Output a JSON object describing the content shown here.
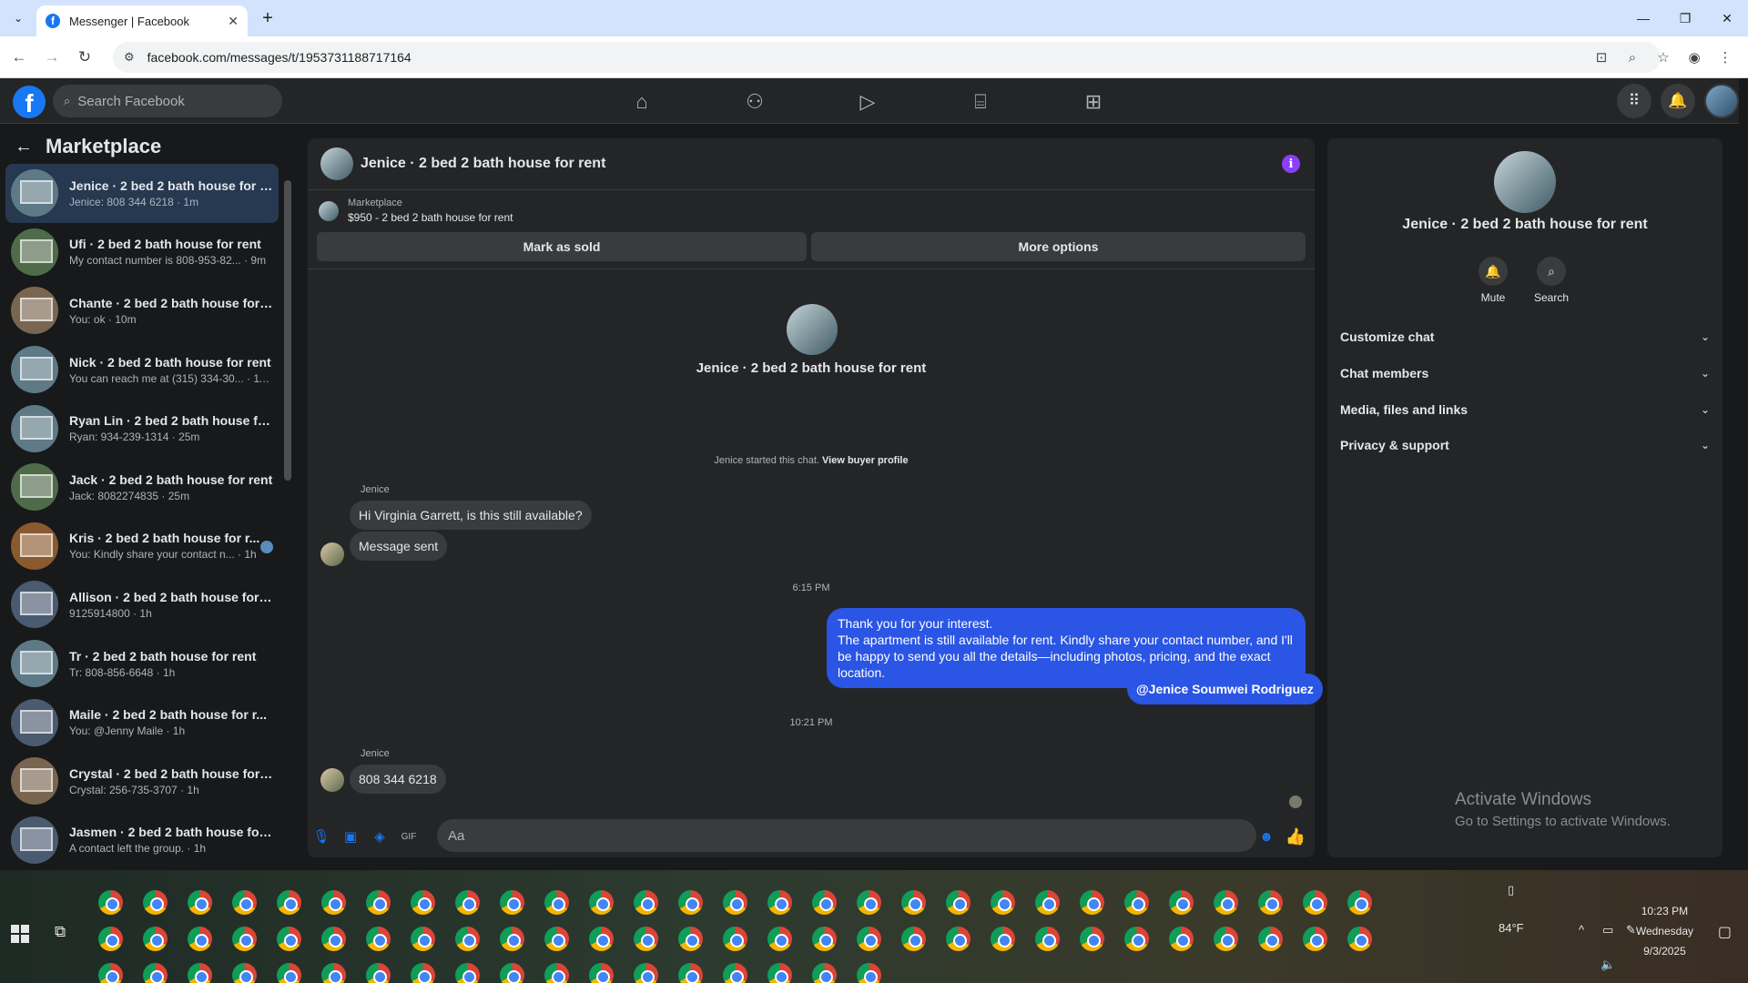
{
  "browser": {
    "tab_title": "Messenger | Facebook",
    "url": "facebook.com/messages/t/1953731188717164"
  },
  "fb": {
    "search_placeholder": "Search Facebook"
  },
  "sidebar": {
    "title": "Marketplace",
    "chats": [
      {
        "name": "Jenice · 2 bed 2 bath house for r...",
        "preview": "Jenice: 808 344 6218 · 1m",
        "active": true,
        "color": "#5d7a86"
      },
      {
        "name": "Ufi · 2 bed 2 bath house for rent",
        "preview": "My contact number is 808-953-82... · 9m",
        "active": false,
        "color": "#4f6b4a"
      },
      {
        "name": "Chante · 2 bed 2 bath house for ...",
        "preview": "You: ok · 10m",
        "active": false,
        "color": "#7a6650"
      },
      {
        "name": "Nick · 2 bed 2 bath house for rent",
        "preview": "You can reach me at (315) 334-30... · 11m",
        "active": false,
        "color": "#5d7a86"
      },
      {
        "name": "Ryan Lin · 2 bed 2 bath house fo...",
        "preview": "Ryan: 934-239-1314 · 25m",
        "active": false,
        "color": "#5d7a86"
      },
      {
        "name": "Jack · 2 bed 2 bath house for rent",
        "preview": "Jack: 8082274835 · 25m",
        "active": false,
        "color": "#4f6b4a"
      },
      {
        "name": "Kris · 2 bed 2 bath house for r...",
        "preview": "You: Kindly share your contact n... · 1h",
        "active": false,
        "color": "#8a5a2e"
      },
      {
        "name": "Allison · 2 bed 2 bath house for ...",
        "preview": "9125914800 · 1h",
        "active": false,
        "color": "#4a5a70"
      },
      {
        "name": "Tr · 2 bed 2 bath house for rent",
        "preview": "Tr: 808-856-6648 · 1h",
        "active": false,
        "color": "#5d7a86"
      },
      {
        "name": "Maile · 2 bed 2 bath house for r...",
        "preview": "You: @Jenny Maile · 1h",
        "active": false,
        "color": "#4a5a70"
      },
      {
        "name": "Crystal · 2 bed 2 bath house for ...",
        "preview": "Crystal: 256-735-3707 · 1h",
        "active": false,
        "color": "#7a6650"
      },
      {
        "name": "Jasmen · 2 bed 2 bath house for...",
        "preview": "A contact left the group. · 1h",
        "active": false,
        "color": "#4a5a70"
      }
    ]
  },
  "conversation": {
    "header_title": "Jenice · 2 bed 2 bath house for rent",
    "marketplace_label": "Marketplace",
    "listing": "$950 - 2 bed 2 bath house for rent",
    "mark_sold": "Mark as sold",
    "more_options": "More options",
    "intro_name": "Jenice · 2 bed 2 bath house for rent",
    "system_msg": "Jenice started this chat.",
    "view_profile": "View buyer profile",
    "sender1": "Jenice",
    "msg1": "Hi Virginia Garrett, is this still available?",
    "msg2": "Message sent",
    "time1": "6:15 PM",
    "my_msg_line1": "Thank you for your interest.",
    "my_msg_line2": "The apartment is still available for rent. Kindly share your contact number, and I'll be happy to send you all the details—including photos, pricing, and the exact location.",
    "mention": "@Jenice Soumwei Rodriguez",
    "time2": "10:21 PM",
    "sender2": "Jenice",
    "msg3": "808 344 6218",
    "composer_placeholder": "Aa"
  },
  "info_panel": {
    "name": "Jenice · 2 bed 2 bath house for rent",
    "mute": "Mute",
    "search": "Search",
    "sections": [
      "Customize chat",
      "Chat members",
      "Media, files and links",
      "Privacy & support"
    ],
    "activate_title": "Activate Windows",
    "activate_sub": "Go to Settings to activate Windows."
  },
  "taskbar": {
    "weather": "84°F",
    "time": "10:23 PM",
    "day": "Wednesday",
    "date": "9/3/2025"
  }
}
